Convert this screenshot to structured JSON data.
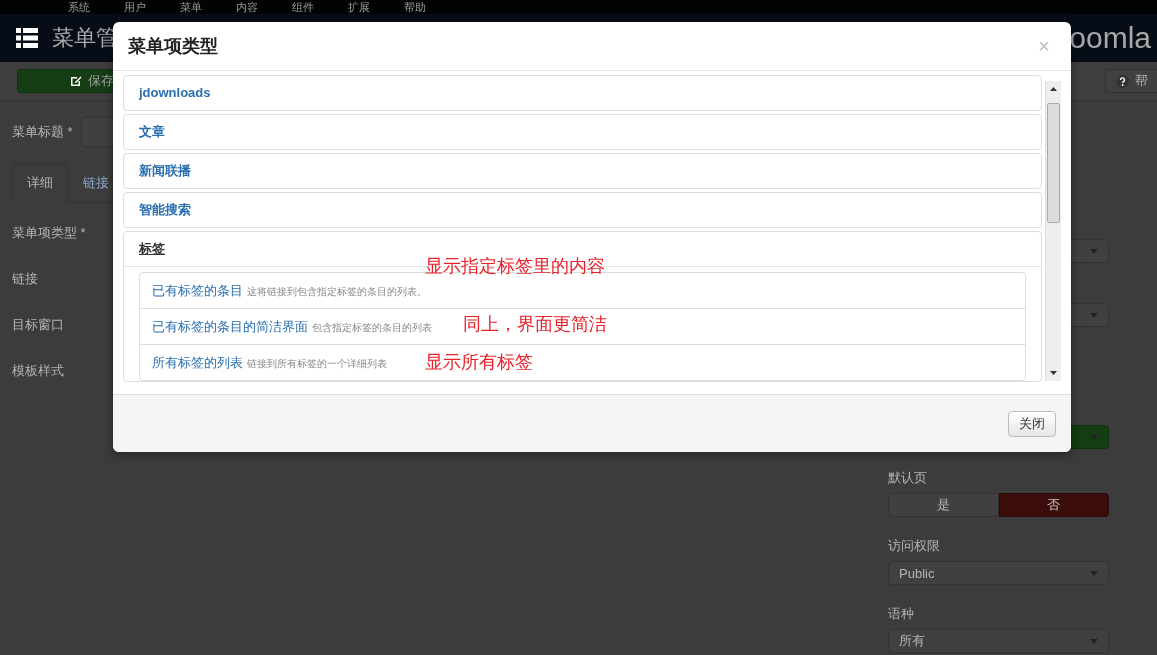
{
  "top_menu": [
    "系统",
    "用户",
    "菜单",
    "内容",
    "组件",
    "扩展",
    "帮助"
  ],
  "header": {
    "title": "菜单管",
    "logo_text": "oomla"
  },
  "toolbar": {
    "save_label": "保存",
    "help_label": "帮"
  },
  "form": {
    "title_label": "菜单标题 *",
    "tabs": [
      {
        "label": "详细",
        "selected": true
      },
      {
        "label": "链接",
        "selected": false
      }
    ],
    "fields": [
      "菜单项类型 *",
      "链接",
      "目标窗口",
      "模板样式"
    ]
  },
  "side_fields": [
    {
      "kind": "select"
    },
    {
      "kind": "select"
    },
    {
      "kind": "status_select"
    },
    {
      "kind": "toggle",
      "label": "默认页",
      "options": [
        {
          "label": "是",
          "selected": false
        },
        {
          "label": "否",
          "selected": true
        }
      ]
    },
    {
      "kind": "select",
      "label": "访问权限",
      "value": "Public"
    },
    {
      "kind": "select",
      "label": "语种",
      "value": "所有"
    }
  ],
  "modal": {
    "title": "菜单项类型",
    "close_icon": "×",
    "close_button": "关闭",
    "groups": [
      {
        "title": "jdownloads",
        "expanded": false
      },
      {
        "title": "文章",
        "expanded": false
      },
      {
        "title": "新闻联播",
        "expanded": false
      },
      {
        "title": "智能搜索",
        "expanded": false
      },
      {
        "title": "标签",
        "expanded": true,
        "items": [
          {
            "title": "已有标签的条目",
            "description": "这将链接到包含指定标签的条目的列表。",
            "note": "显示指定标签里的内容"
          },
          {
            "title": "已有标签的条目的简洁界面",
            "description": "包含指定标签的条目的列表",
            "note": "同上，界面更简洁"
          },
          {
            "title": "所有标签的列表",
            "description": "链接到所有标签的一个详细列表",
            "note": "显示所有标签"
          }
        ]
      }
    ]
  }
}
